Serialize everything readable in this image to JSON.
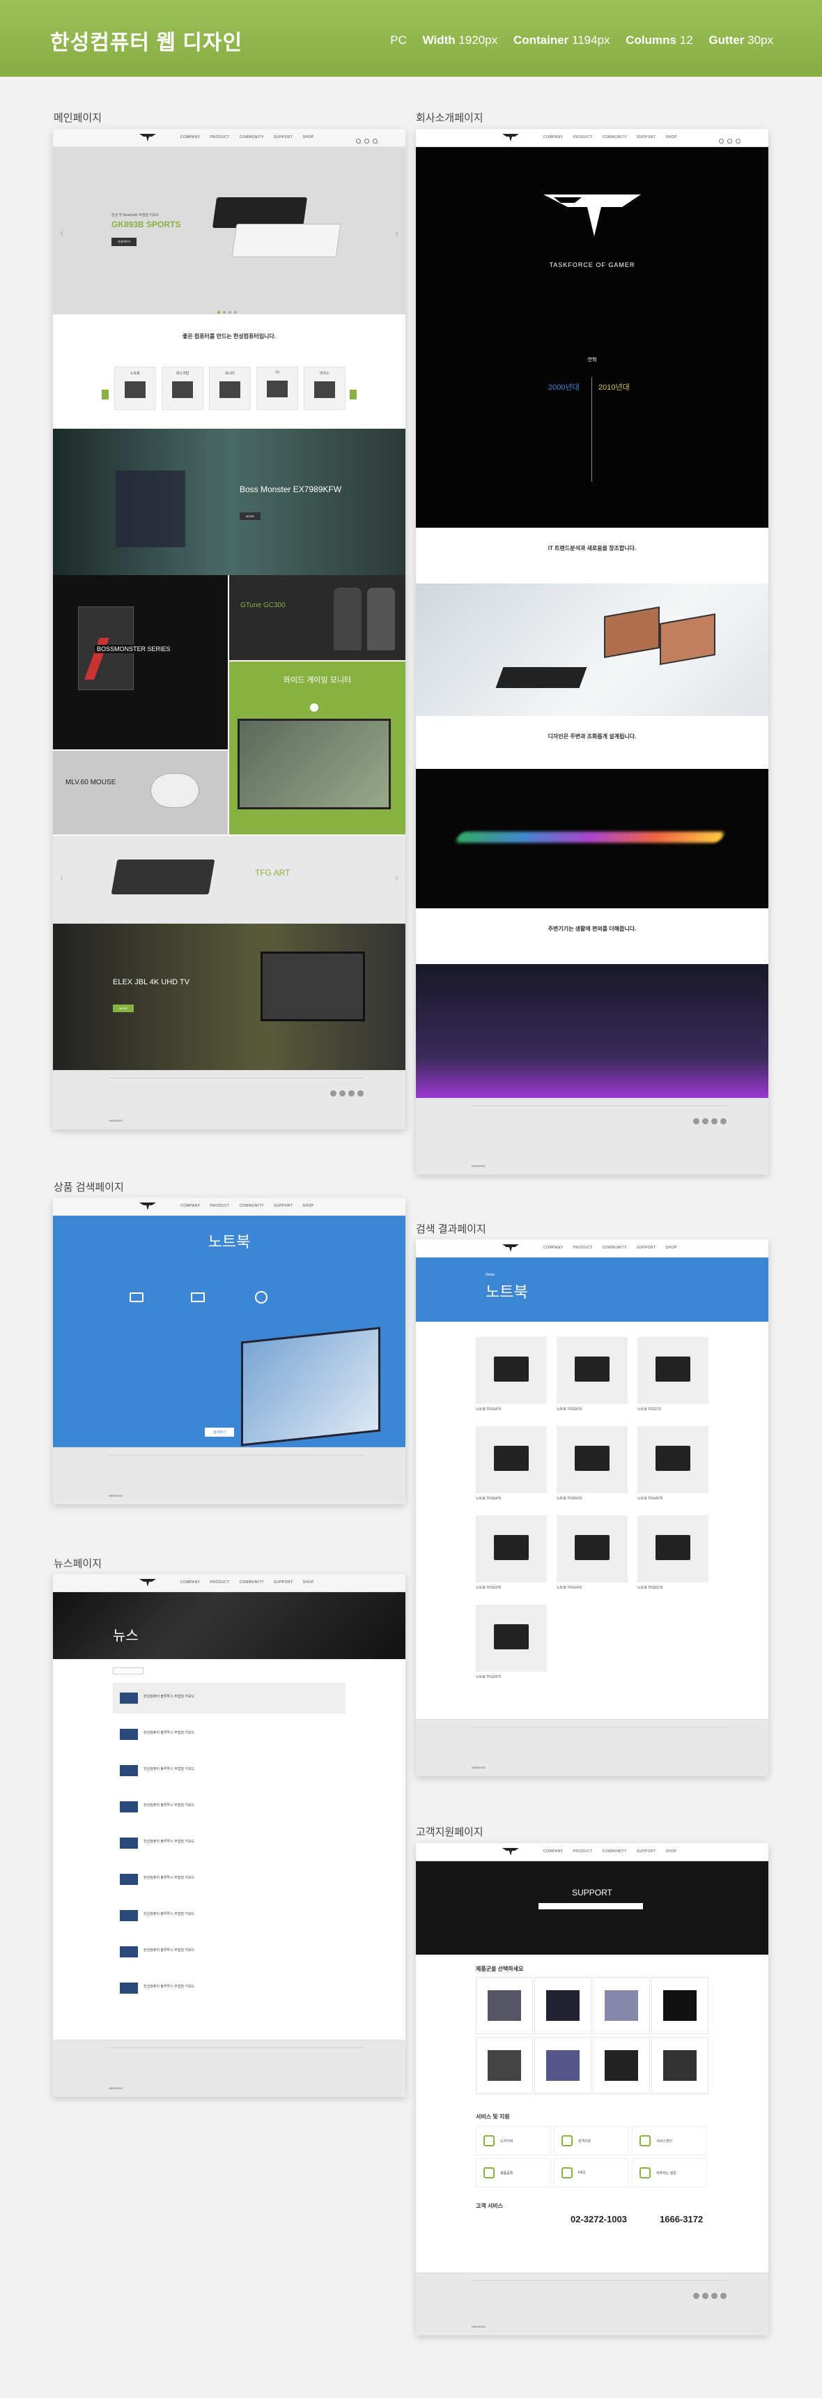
{
  "header": {
    "title": "한성컴퓨터 웹 디자인",
    "device": "PC",
    "width_label": "Width",
    "width_value": "1920px",
    "container_label": "Container",
    "container_value": "1194px",
    "columns_label": "Columns",
    "columns_value": "12",
    "gutter_label": "Gutter",
    "gutter_value": "30px"
  },
  "sections": {
    "main": "메인페이지",
    "about": "회사소개페이지",
    "product_search": "상품 검색페이지",
    "search_results": "검색 결과페이지",
    "news": "뉴스페이지",
    "support": "고객지원페이지"
  },
  "main_page": {
    "hero_small": "한성 첫 Bluetooth 무접점 키보드",
    "hero_title": "GK893B SPORTS",
    "hero_btn": "자세히보기",
    "intro_title": "좋은 컴퓨터를 만드는 한성컴퓨터입니다.",
    "category_items": [
      "노트북",
      "데스크탑",
      "모니터",
      "TV",
      "마우스"
    ],
    "boss_title": "Boss Monster EX7989KFW",
    "bossmonster": "BOSSMONSTER SERIES",
    "gtune": "GTune GC300",
    "wide_title": "와이드 게이밍 모니터",
    "mouse_title": "MLV.60 MOUSE",
    "tfg_art": "TFG ART",
    "tv_title": "ELEX JBL 4K UHD TV"
  },
  "about_page": {
    "slogan": "TASKFORCE OF GAMER",
    "history_label": "연혁",
    "year_2000": "2000년대",
    "year_2010": "2010년대",
    "it_title": "IT 트렌드분석과 새로움을 창조합니다.",
    "design_title": "디자인은 주변과 조화롭게 설계됩니다.",
    "life_title": "주변기기는 생활에 편의를 더해줍니다."
  },
  "search_page": {
    "title": "노트북",
    "categories": [
      "노트북",
      "데스크탑",
      "게임"
    ],
    "search_btn": "검색하기"
  },
  "results_page": {
    "crumb": "Home",
    "title": "노트북",
    "products": [
      "노트북 TFG5470",
      "노트북 TFG5576",
      "노트북 TFG173",
      "노트북 TFG5476",
      "노트북 TFG5470",
      "노트북 TFG4576",
      "노트북 TFG5376",
      "노트북 TFG1470",
      "노트북 TFG5176",
      "노트북 TFG2470"
    ]
  },
  "news_page": {
    "title": "뉴스",
    "item_text": "한성컴퓨터 블루투스 무접점 키보드",
    "item_count": 9
  },
  "support_page": {
    "banner_title": "SUPPORT",
    "pick_title": "제품군을 선택하세요",
    "service_title": "서비스 및 지원",
    "services": [
      "드라이버",
      "원격지원",
      "서비스센터",
      "제품등록",
      "FAQ",
      "자주하는 질문"
    ],
    "contact_title": "고객 서비스",
    "phone1": "02-3272-1003",
    "phone2": "1666-3172"
  },
  "footer": {
    "brand": "HANSUNG",
    "cols": [
      "회사소개",
      "제품",
      "지원",
      "뉴스"
    ]
  },
  "colors": {
    "accent": "#87b242",
    "blue": "#3d86d4",
    "dark": "#111111"
  }
}
